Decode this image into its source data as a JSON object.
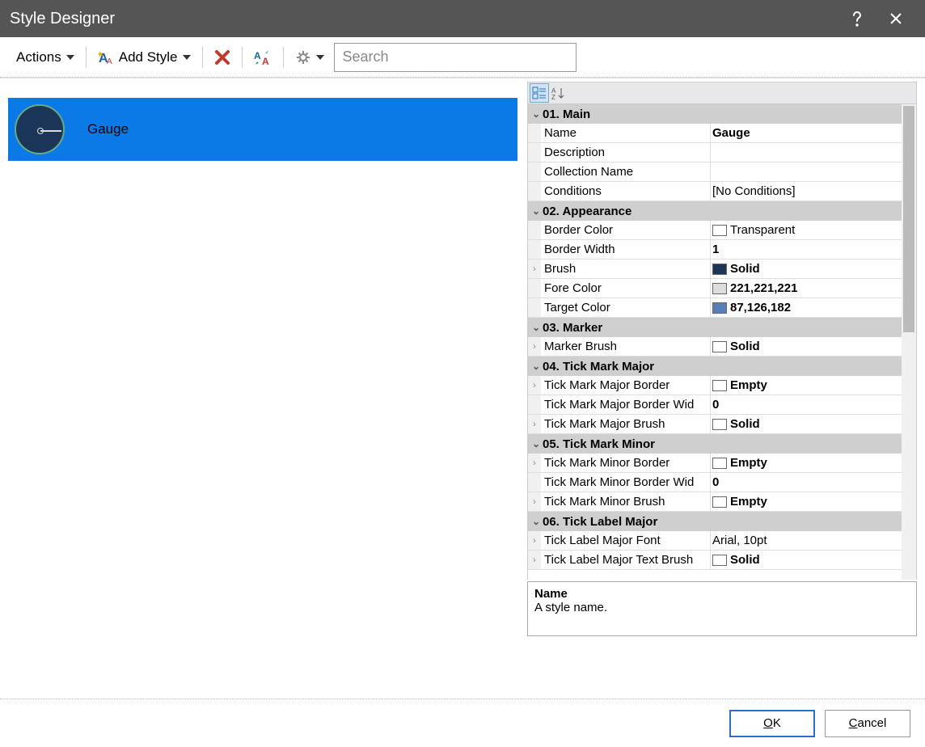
{
  "title": "Style Designer",
  "toolbar": {
    "actions_label": "Actions",
    "add_style_label": "Add Style",
    "search_placeholder": "Search"
  },
  "left": {
    "selected_style_label": "Gauge"
  },
  "propgrid": {
    "categories": [
      {
        "header": "01. Main",
        "rows": [
          {
            "exp": "",
            "name": "Name",
            "value": "Gauge",
            "bold": true,
            "swatch": null
          },
          {
            "exp": "",
            "name": "Description",
            "value": "",
            "bold": false,
            "swatch": null
          },
          {
            "exp": "",
            "name": "Collection Name",
            "value": "",
            "bold": false,
            "swatch": null
          },
          {
            "exp": "",
            "name": "Conditions",
            "value": "[No Conditions]",
            "bold": false,
            "swatch": null
          }
        ]
      },
      {
        "header": "02. Appearance",
        "rows": [
          {
            "exp": "",
            "name": "Border Color",
            "value": "Transparent",
            "bold": false,
            "swatch": "#ffffff"
          },
          {
            "exp": "",
            "name": "Border Width",
            "value": "1",
            "bold": true,
            "swatch": null
          },
          {
            "exp": "›",
            "name": "Brush",
            "value": "Solid",
            "bold": true,
            "swatch": "#1b3658"
          },
          {
            "exp": "",
            "name": "Fore Color",
            "value": "221,221,221",
            "bold": true,
            "swatch": "#dddddd"
          },
          {
            "exp": "",
            "name": "Target Color",
            "value": "87,126,182",
            "bold": true,
            "swatch": "#577eb6"
          }
        ]
      },
      {
        "header": "03. Marker",
        "rows": [
          {
            "exp": "›",
            "name": "Marker Brush",
            "value": "Solid",
            "bold": true,
            "swatch": "#ffffff"
          }
        ]
      },
      {
        "header": "04. Tick  Mark  Major",
        "rows": [
          {
            "exp": "›",
            "name": "Tick Mark Major Border",
            "value": "Empty",
            "bold": true,
            "swatch": "#ffffff"
          },
          {
            "exp": "",
            "name": "Tick Mark Major Border Wid",
            "value": "0",
            "bold": true,
            "swatch": null
          },
          {
            "exp": "›",
            "name": "Tick Mark Major Brush",
            "value": "Solid",
            "bold": true,
            "swatch": "#ffffff"
          }
        ]
      },
      {
        "header": "05. Tick  Mark  Minor",
        "rows": [
          {
            "exp": "›",
            "name": "Tick Mark Minor Border",
            "value": "Empty",
            "bold": true,
            "swatch": "#ffffff"
          },
          {
            "exp": "",
            "name": "Tick Mark Minor Border Wid",
            "value": "0",
            "bold": true,
            "swatch": null
          },
          {
            "exp": "›",
            "name": "Tick Mark Minor Brush",
            "value": "Empty",
            "bold": true,
            "swatch": "#ffffff"
          }
        ]
      },
      {
        "header": "06. Tick  Label  Major",
        "rows": [
          {
            "exp": "›",
            "name": "Tick Label Major Font",
            "value": "Arial, 10pt",
            "bold": false,
            "swatch": null
          },
          {
            "exp": "›",
            "name": "Tick Label Major Text Brush",
            "value": "Solid",
            "bold": true,
            "swatch": "#ffffff"
          }
        ]
      }
    ],
    "help_title": "Name",
    "help_desc": "A style name."
  },
  "footer": {
    "ok_label": "OK",
    "ok_accel": "O",
    "cancel_label": "Cancel",
    "cancel_accel": "C"
  }
}
